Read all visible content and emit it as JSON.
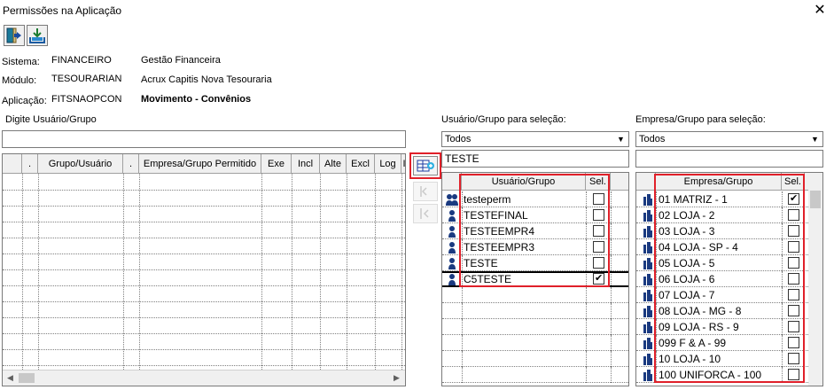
{
  "window": {
    "title": "Permissões na Aplicação",
    "close_glyph": "✕"
  },
  "toolbar": {
    "exit_icon": "exit-door-icon",
    "save_icon": "save-tray-icon"
  },
  "info": {
    "sistema_label": "Sistema:",
    "sistema_code": "FINANCEIRO",
    "sistema_desc": "Gestão Financeira",
    "modulo_label": "Módulo:",
    "modulo_code": "TESOURARIAN",
    "modulo_desc": "Acrux Capitis Nova Tesouraria",
    "aplicacao_label": "Aplicação:",
    "aplicacao_code": "FITSNAOPCON",
    "aplicacao_desc": "Movimento - Convênios"
  },
  "left": {
    "search_label": "Digite Usuário/Grupo",
    "search_value": "",
    "columns": [
      ".",
      "Grupo/Usuário",
      ".",
      "Empresa/Grupo Permitido",
      "Exe",
      "Incl",
      "Alte",
      "Excl",
      "Log"
    ],
    "overflow_header": "I"
  },
  "users": {
    "label": "Usuário/Grupo para seleção:",
    "filter_value": "Todos",
    "search_value": "TESTE",
    "col_name": "Usuário/Grupo",
    "col_sel": "Sel.",
    "rows": [
      {
        "name": "testeperm",
        "icon": "group-icon",
        "selected": false
      },
      {
        "name": "TESTEFINAL",
        "icon": "user-icon",
        "selected": false
      },
      {
        "name": "TESTEEMPR4",
        "icon": "user-icon",
        "selected": false
      },
      {
        "name": "TESTEEMPR3",
        "icon": "user-icon",
        "selected": false
      },
      {
        "name": "TESTE",
        "icon": "user-icon",
        "selected": false
      },
      {
        "name": "C5TESTE",
        "icon": "user-icon",
        "selected": true
      }
    ]
  },
  "companies": {
    "label": "Empresa/Grupo para seleção:",
    "filter_value": "Todos",
    "search_value": "",
    "col_name": "Empresa/Grupo",
    "col_sel": "Sel.",
    "rows": [
      {
        "name": "01 MATRIZ - 1",
        "selected": true
      },
      {
        "name": "02 LOJA - 2",
        "selected": false
      },
      {
        "name": "03 LOJA - 3",
        "selected": false
      },
      {
        "name": "04 LOJA - SP - 4",
        "selected": false
      },
      {
        "name": "05 LOJA - 5",
        "selected": false
      },
      {
        "name": "06 LOJA - 6",
        "selected": false
      },
      {
        "name": "07 LOJA - 7",
        "selected": false
      },
      {
        "name": "08 LOJA - MG - 8",
        "selected": false
      },
      {
        "name": "09 LOJA - RS - 9",
        "selected": false
      },
      {
        "name": "099 F & A - 99",
        "selected": false
      },
      {
        "name": "10 LOJA - 10",
        "selected": false
      },
      {
        "name": "100 UNIFORCA - 100",
        "selected": false
      }
    ]
  },
  "colors": {
    "highlight": "#e0202a",
    "window_bg": "#ffffff",
    "header_bg": "#f0f0f0"
  }
}
